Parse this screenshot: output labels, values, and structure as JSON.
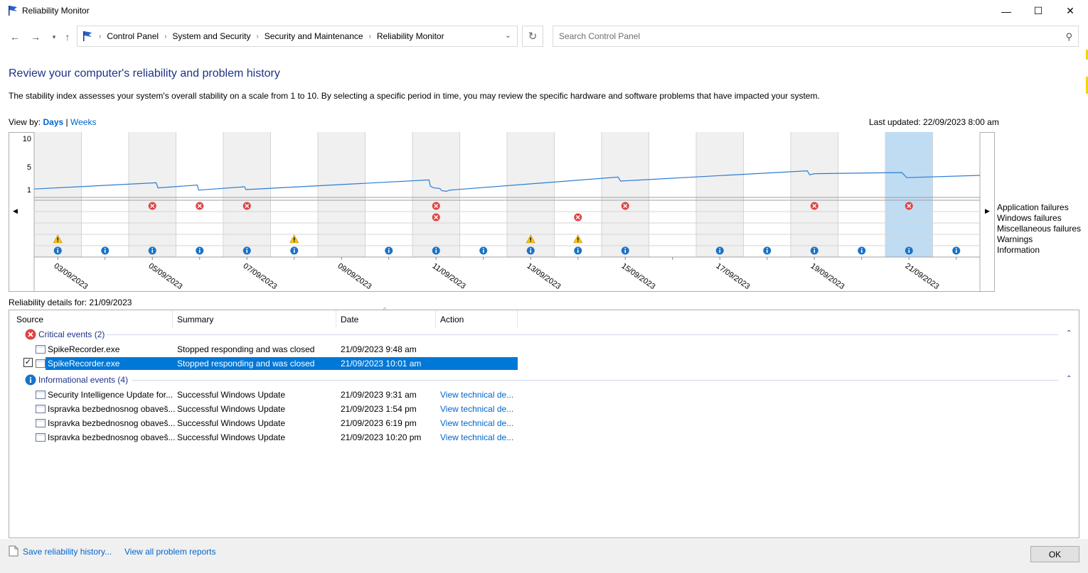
{
  "window": {
    "title": "Reliability Monitor",
    "minimize": "—",
    "maximize": "☐",
    "close": "✕"
  },
  "address": {
    "crumbs": [
      "Control Panel",
      "System and Security",
      "Security and Maintenance",
      "Reliability Monitor"
    ],
    "search_placeholder": "Search Control Panel"
  },
  "page": {
    "heading": "Review your computer's reliability and problem history",
    "description": "The stability index assesses your system's overall stability on a scale from 1 to 10. By selecting a specific period in time, you may review the specific hardware and software problems that have impacted your system.",
    "view_by_label": "View by:",
    "view_days": "Days",
    "view_sep": "|",
    "view_weeks": "Weeks",
    "last_updated": "Last updated: 22/09/2023 8:00 am"
  },
  "chart_data": {
    "type": "line",
    "y_ticks": [
      "10",
      "5",
      "1"
    ],
    "ylim": [
      1,
      10
    ],
    "columns": 20,
    "selected_column": 18,
    "x_labels": [
      {
        "col": 0,
        "text": "03/09/2023"
      },
      {
        "col": 2,
        "text": "05/09/2023"
      },
      {
        "col": 4,
        "text": "07/09/2023"
      },
      {
        "col": 6,
        "text": "09/09/2023"
      },
      {
        "col": 8,
        "text": "11/09/2023"
      },
      {
        "col": 10,
        "text": "13/09/2023"
      },
      {
        "col": 12,
        "text": "15/09/2023"
      },
      {
        "col": 14,
        "text": "17/09/2023"
      },
      {
        "col": 16,
        "text": "19/09/2023"
      },
      {
        "col": 18,
        "text": "21/09/2023"
      }
    ],
    "stability_index": [
      [
        0.0,
        1.1
      ],
      [
        2.58,
        2.2
      ],
      [
        2.62,
        1.3
      ],
      [
        3.45,
        1.8
      ],
      [
        3.48,
        0.9
      ],
      [
        4.45,
        1.5
      ],
      [
        4.48,
        1.0
      ],
      [
        8.35,
        2.7
      ],
      [
        8.38,
        1.6
      ],
      [
        8.45,
        1.3
      ],
      [
        8.58,
        1.2
      ],
      [
        8.62,
        0.8
      ],
      [
        8.72,
        0.7
      ],
      [
        8.78,
        0.9
      ],
      [
        12.35,
        3.2
      ],
      [
        12.4,
        2.5
      ],
      [
        16.35,
        4.3
      ],
      [
        16.4,
        3.6
      ],
      [
        16.5,
        3.8
      ],
      [
        18.35,
        4.0
      ],
      [
        18.45,
        3.1
      ],
      [
        20.0,
        3.5
      ]
    ],
    "legend": [
      "Application failures",
      "Windows failures",
      "Miscellaneous failures",
      "Warnings",
      "Information"
    ],
    "events": {
      "application_failures": [
        2,
        3,
        4,
        8,
        12,
        16,
        18
      ],
      "windows_failures": [
        8,
        11
      ],
      "miscellaneous_failures": [],
      "warnings": [
        0,
        5,
        10,
        11
      ],
      "information": [
        0,
        1,
        2,
        3,
        4,
        5,
        7,
        8,
        9,
        10,
        11,
        12,
        14,
        15,
        16,
        17,
        18,
        19
      ]
    },
    "colors": {
      "line": "#2b7cd3",
      "shade": "#f0f0f0",
      "selected": "#bfdcf3",
      "error": "#e04343",
      "warning": "#f5c518",
      "info": "#1a73c8"
    }
  },
  "details": {
    "label": "Reliability details for: 21/09/2023",
    "columns": [
      "Source",
      "Summary",
      "Date",
      "Action"
    ],
    "critical_header": "Critical events (2)",
    "critical_rows": [
      {
        "source": "SpikeRecorder.exe",
        "summary": "Stopped responding and was closed",
        "date": "21/09/2023 9:48 am",
        "action": ""
      },
      {
        "source": "SpikeRecorder.exe",
        "summary": "Stopped responding and was closed",
        "date": "21/09/2023 10:01 am",
        "action": ""
      }
    ],
    "info_header": "Informational events (4)",
    "info_rows": [
      {
        "source": "Security Intelligence Update for...",
        "summary": "Successful Windows Update",
        "date": "21/09/2023 9:31 am",
        "action": "View technical de..."
      },
      {
        "source": "Ispravka bezbednosnog obaveš...",
        "summary": "Successful Windows Update",
        "date": "21/09/2023 1:54 pm",
        "action": "View technical de..."
      },
      {
        "source": "Ispravka bezbednosnog obaveš...",
        "summary": "Successful Windows Update",
        "date": "21/09/2023 6:19 pm",
        "action": "View technical de..."
      },
      {
        "source": "Ispravka bezbednosnog obaveš...",
        "summary": "Successful Windows Update",
        "date": "21/09/2023 10:20 pm",
        "action": "View technical de..."
      }
    ]
  },
  "footer": {
    "save_history": "Save reliability history...",
    "view_reports": "View all problem reports",
    "ok": "OK"
  }
}
